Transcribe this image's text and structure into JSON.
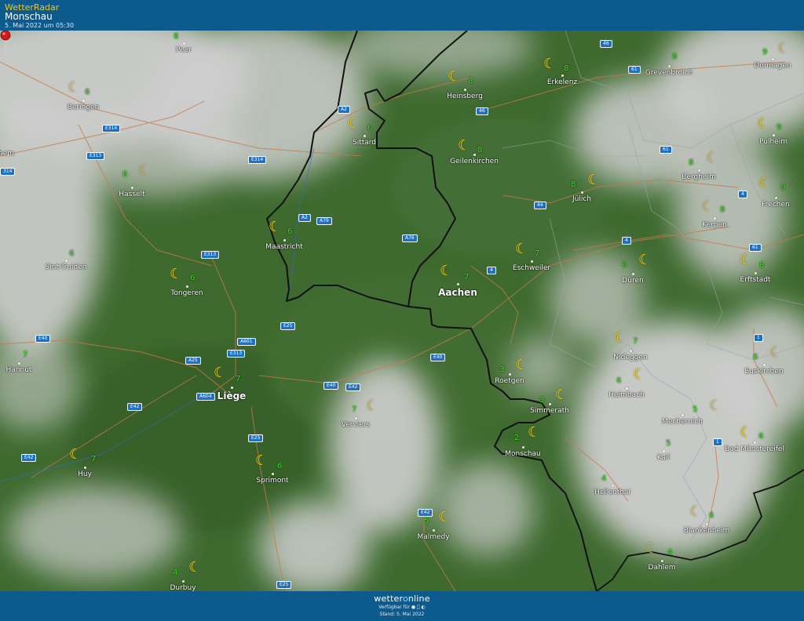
{
  "header": {
    "brand": "WetterRadar",
    "location": "Monschau",
    "timestamp": "5. Mai 2022 um 05:30"
  },
  "footer": {
    "logo_before": "wetter",
    "logo_o": "o",
    "logo_after": "nline",
    "availability": "Verfügbar für",
    "stand": "Stand: 5. Mai 2022"
  },
  "colors": {
    "header_bg": "#0d5b8c",
    "forest": "#3f6a30",
    "cloud": "#c9c9c9",
    "temperature": "#35e21d",
    "moon": "#f3d21d",
    "road_shield": "#1d72c8",
    "border": "#111111",
    "pin": "#d51818"
  },
  "selected_location": "Monschau",
  "roads": [
    "E314",
    "E313",
    "E314",
    "314",
    "A2",
    "46",
    "61",
    "46",
    "61",
    "A2",
    "A79",
    "A76",
    "E313",
    "44",
    "4",
    "4",
    "4",
    "61",
    "E25",
    "A601",
    "E313",
    "E40",
    "A25",
    "E40",
    "E40",
    "E42",
    "1",
    "A604",
    "E42",
    "E25",
    "E42",
    "1",
    "E42",
    "E25"
  ],
  "cities": [
    {
      "name": "Peer",
      "temp": "8",
      "icon": "none"
    },
    {
      "name": "Beringen",
      "temp": "6",
      "icon": "moon-dim"
    },
    {
      "name": "hem",
      "temp": "",
      "icon": "none"
    },
    {
      "name": "Hasselt",
      "temp": "6",
      "icon": "moon-dim"
    },
    {
      "name": "Sint-Truiden",
      "temp": "6",
      "icon": "none"
    },
    {
      "name": "Tongeren",
      "temp": "6",
      "icon": "moon"
    },
    {
      "name": "Hannut",
      "temp": "7",
      "icon": "none"
    },
    {
      "name": "Liège",
      "temp": "7",
      "icon": "moon"
    },
    {
      "name": "Huy",
      "temp": "7",
      "icon": "moon"
    },
    {
      "name": "Sprimont",
      "temp": "6",
      "icon": "moon"
    },
    {
      "name": "Durbuy",
      "temp": "4",
      "icon": "moon"
    },
    {
      "name": "Verviers",
      "temp": "7",
      "icon": "moon-dim"
    },
    {
      "name": "Malmedy",
      "temp": "5",
      "icon": "moon"
    },
    {
      "name": "Maastricht",
      "temp": "6",
      "icon": "moon"
    },
    {
      "name": "Sittard",
      "temp": "6",
      "icon": "moon"
    },
    {
      "name": "Heinsberg",
      "temp": "8",
      "icon": "moon"
    },
    {
      "name": "Erkelenz",
      "temp": "8",
      "icon": "moon"
    },
    {
      "name": "Geilenkirchen",
      "temp": "8",
      "icon": "moon"
    },
    {
      "name": "Aachen",
      "temp": "7",
      "icon": "moon"
    },
    {
      "name": "Eschweiler",
      "temp": "7",
      "icon": "moon"
    },
    {
      "name": "Jülich",
      "temp": "8",
      "icon": "moon"
    },
    {
      "name": "Roetgen",
      "temp": "3",
      "icon": "moon"
    },
    {
      "name": "Simmerath",
      "temp": "3",
      "icon": "moon"
    },
    {
      "name": "Monschau",
      "temp": "2",
      "icon": "moon"
    },
    {
      "name": "Düren",
      "temp": "9",
      "icon": "moon"
    },
    {
      "name": "Nideggen",
      "temp": "7",
      "icon": "moon"
    },
    {
      "name": "Heimbach",
      "temp": "6",
      "icon": "moon"
    },
    {
      "name": "Hellenthal",
      "temp": "4",
      "icon": "none"
    },
    {
      "name": "Grevenbroich",
      "temp": "8",
      "icon": "none"
    },
    {
      "name": "Dormagen",
      "temp": "9",
      "icon": "moon-dim"
    },
    {
      "name": "Pulheim",
      "temp": "9",
      "icon": "moon"
    },
    {
      "name": "Bergheim",
      "temp": "8",
      "icon": "moon-dim"
    },
    {
      "name": "Frechen",
      "temp": "9",
      "icon": "moon"
    },
    {
      "name": "Kerpen",
      "temp": "8",
      "icon": "moon-dim"
    },
    {
      "name": "Erftstadt",
      "temp": "8",
      "icon": "moon"
    },
    {
      "name": "Euskirchen",
      "temp": "6",
      "icon": "moon-dim"
    },
    {
      "name": "Mechernich",
      "temp": "5",
      "icon": "moon-dim"
    },
    {
      "name": "Bad Münstereifel",
      "temp": "6",
      "icon": "moon"
    },
    {
      "name": "Kall",
      "temp": "5",
      "icon": "none"
    },
    {
      "name": "Blankenheim",
      "temp": "6",
      "icon": "moon-dim"
    },
    {
      "name": "Dahlem",
      "temp": "4",
      "icon": "moon-dim"
    }
  ]
}
